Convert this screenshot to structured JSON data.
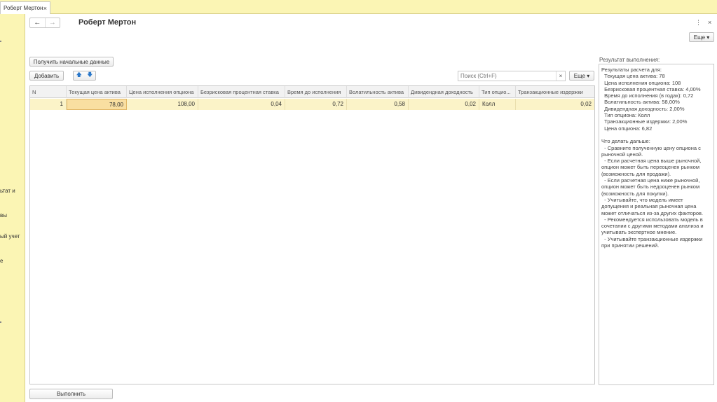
{
  "tab": {
    "title": "Роберт Мертон",
    "close": "×"
  },
  "sidebar": {
    "fragments": [
      "ьтат и",
      "вы",
      "ый учет",
      "е"
    ]
  },
  "header": {
    "back": "←",
    "forward": "→",
    "title": "Роберт Мертон",
    "more_menu": "⋮",
    "close": "×",
    "more_button": "Еще ▾"
  },
  "toolbar": {
    "get_data": "Получить начальные данные",
    "add": "Добавить",
    "up": "🡅",
    "down": "🡇",
    "search_placeholder": "Поиск (Ctrl+F)",
    "search_clear": "×",
    "more_button": "Еще ▾"
  },
  "table": {
    "columns": [
      "N",
      "Текущая цена актива",
      "Цена исполнения опциона",
      "Безрисковая процентная ставка",
      "Время до исполнения",
      "Волатильность актива",
      "Дивидендная доходность",
      "Тип опцио...",
      "Транзакционные издержки"
    ],
    "rows": [
      [
        "1",
        "78,00",
        "108,00",
        "0,04",
        "0,72",
        "0,58",
        "0,02",
        "Колл",
        "0,02"
      ]
    ]
  },
  "result": {
    "label": "Результат выполнения:",
    "lines": [
      "Результаты расчета для:",
      "  Текущая цена актива: 78",
      "  Цена исполнения опциона: 108",
      "  Безрисковая процентная ставка: 4,00%",
      "  Время до исполнения (в годах): 0,72",
      "  Волатильность актива: 58,00%",
      "  Дивидендная доходность: 2,00%",
      "  Тип опциона: Колл",
      "  Транзакционные издержки: 2,00%",
      "  Цена опциона: 6,82",
      "",
      "Что делать дальше:",
      "  - Сравните полученную цену опциона с",
      "рыночной ценой.",
      "  - Если расчетная цена выше рыночной,",
      "опцион может быть переоценен рынком",
      "(возможность для продажи).",
      "  - Если расчетная цена ниже рыночной,",
      "опцион может быть недооценен рынком",
      "(возможность для покупки).",
      "  - Учитывайте, что модель имеет",
      "допущения и реальная рыночная цена",
      "может отличаться из-за других факторов.",
      "  - Рекомендуется использовать модель в",
      "сочетании с другими методами анализа и",
      "учитывать экспертное мнение.",
      "  - Учитывайте транзакционные издержки",
      "при принятии решений."
    ]
  },
  "footer": {
    "run": "Выполнить"
  }
}
